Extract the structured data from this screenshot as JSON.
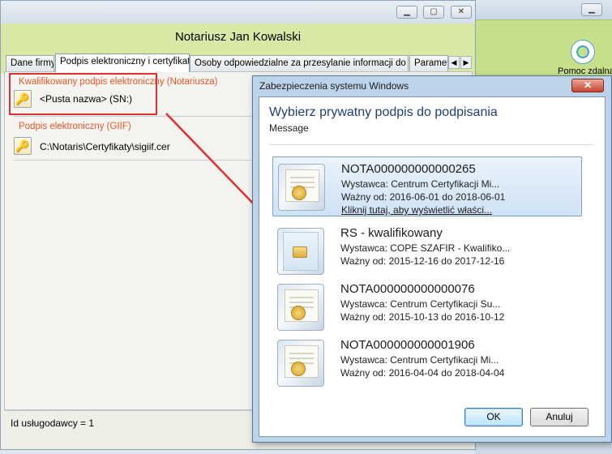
{
  "background_window": {
    "help_label": "Pomoc zdalna"
  },
  "main_window": {
    "title": "Notariusz Jan Kowalski",
    "tabs": [
      {
        "label": "Dane firmy"
      },
      {
        "label": "Podpis elektroniczny i certyfikaty"
      },
      {
        "label": "Osoby odpowiedzialne za przesylanie informacji do GIIF"
      },
      {
        "label": "Parametr"
      }
    ],
    "group_qualified": {
      "title": "Kwalifikowany podpis elektroniczny (Notariusza)",
      "value": "<Pusta nazwa> (SN:)"
    },
    "group_giif": {
      "title": "Podpis elektroniczny (GIIF)",
      "value": "C:\\Notaris\\Certyfikaty\\sigiif.cer"
    },
    "status": "Id usługodawcy = 1"
  },
  "dialog": {
    "title": "Zabezpieczenia systemu Windows",
    "heading": "Wybierz prywatny podpis do podpisania",
    "message": "Message",
    "certificates": [
      {
        "name": "NOTA000000000000265",
        "issuer": "Wystawca: Centrum Certyfikacji Mi...",
        "valid": "Ważny od: 2016-06-01 do 2018-06-01",
        "link": "Kliknij tutaj, aby wyświetlić właści...",
        "icon": "certificate-icon",
        "selected": true
      },
      {
        "name": "RS - kwalifikowany",
        "issuer": "Wystawca: COPE SZAFIR - Kwalifiko...",
        "valid": "Ważny od: 2015-12-16 do 2017-12-16",
        "icon": "smartcard-icon",
        "selected": false
      },
      {
        "name": "NOTA000000000000076",
        "issuer": "Wystawca: Centrum Certyfikacji Su...",
        "valid": "Ważny od: 2015-10-13 do 2016-10-12",
        "icon": "certificate-icon",
        "selected": false
      },
      {
        "name": "NOTA000000000001906",
        "issuer": "Wystawca: Centrum Certyfikacji Mi...",
        "valid": "Ważny od: 2016-04-04 do 2018-04-04",
        "icon": "certificate-icon",
        "selected": false
      }
    ],
    "ok_label": "OK",
    "cancel_label": "Anuluj",
    "close_glyph": "✕"
  },
  "colors": {
    "accent_green": "#d9e8a5",
    "annotation_red": "#e03030",
    "group_title_orange": "#e8582a",
    "dialog_heading_blue": "#1f3f7a"
  }
}
